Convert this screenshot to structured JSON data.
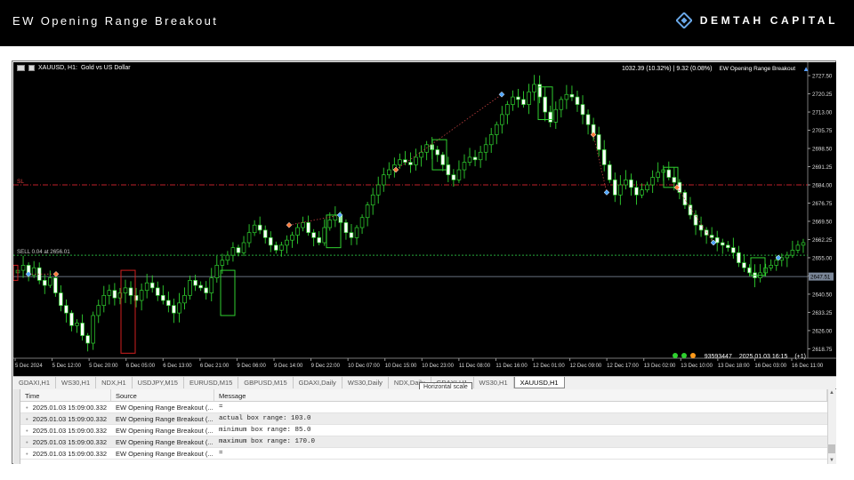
{
  "banner": {
    "title": "EW Opening Range Breakout",
    "brand": "DEMTAH CAPITAL"
  },
  "chart": {
    "symbol": "XAUUSD, H1:",
    "description": "Gold vs US Dollar",
    "account_info": "1032.39 (10.32%) | 9.32 (0.08%)",
    "ea_label": "EW Opening Range Breakout",
    "sl_label": "SL",
    "sell_label": "SELL 0.04 at 2656.01",
    "current_price": "2647.51",
    "account_number": "93593447",
    "server_time": "2025.01.03 16:15",
    "ping": "(+1)",
    "status_colors": [
      "#2fd12f",
      "#2fd12f",
      "#ff9a1a"
    ],
    "y_ticks": [
      "2727.50",
      "2720.25",
      "2713.00",
      "2705.75",
      "2698.50",
      "2691.25",
      "2684.00",
      "2676.75",
      "2669.50",
      "2662.25",
      "2655.00",
      "2647.75",
      "2640.50",
      "2633.25",
      "2626.00",
      "2618.75"
    ],
    "x_ticks": [
      "5 Dec 2024",
      "5 Dec 12:00",
      "5 Dec 20:00",
      "6 Dec 05:00",
      "6 Dec 13:00",
      "6 Dec 21:00",
      "9 Dec 06:00",
      "9 Dec 14:00",
      "9 Dec 22:00",
      "10 Dec 07:00",
      "10 Dec 15:00",
      "10 Dec 23:00",
      "11 Dec 08:00",
      "11 Dec 16:00",
      "12 Dec 01:00",
      "12 Dec 09:00",
      "12 Dec 17:00",
      "13 Dec 02:00",
      "13 Dec 10:00",
      "13 Dec 18:00",
      "16 Dec 03:00",
      "16 Dec 11:00"
    ]
  },
  "chart_data": {
    "type": "candlestick",
    "ylim": [
      2615,
      2730
    ],
    "close_path": [
      2650,
      2652,
      2648,
      2651,
      2646,
      2644,
      2647,
      2641,
      2636,
      2633,
      2628,
      2629,
      2624,
      2621,
      2632,
      2636,
      2640,
      2642,
      2639,
      2641,
      2643,
      2640,
      2638,
      2642,
      2645,
      2643,
      2640,
      2638,
      2636,
      2633,
      2637,
      2640,
      2646,
      2644,
      2643,
      2641,
      2647,
      2652,
      2654,
      2656,
      2659,
      2657,
      2661,
      2665,
      2668,
      2666,
      2663,
      2660,
      2658,
      2660,
      2662,
      2664,
      2667,
      2669,
      2665,
      2663,
      2661,
      2667,
      2670,
      2672,
      2669,
      2665,
      2663,
      2667,
      2671,
      2676,
      2680,
      2684,
      2688,
      2690,
      2692,
      2694,
      2693,
      2692,
      2695,
      2697,
      2700,
      2698,
      2696,
      2692,
      2688,
      2686,
      2690,
      2693,
      2695,
      2694,
      2697,
      2700,
      2704,
      2708,
      2712,
      2716,
      2719,
      2718,
      2716,
      2721,
      2724,
      2719,
      2713,
      2709,
      2714,
      2718,
      2720,
      2719,
      2716,
      2712,
      2708,
      2704,
      2698,
      2692,
      2686,
      2680,
      2684,
      2686,
      2683,
      2680,
      2682,
      2684,
      2687,
      2689,
      2690,
      2687,
      2685,
      2681,
      2676,
      2672,
      2668,
      2666,
      2664,
      2663,
      2661,
      2660,
      2659,
      2657,
      2653,
      2651,
      2649,
      2647,
      2649,
      2651,
      2652,
      2654,
      2655,
      2656,
      2658,
      2660,
      2661
    ]
  },
  "tabs": [
    "GDAXI,H1",
    "WS30,H1",
    "NDX,H1",
    "USDJPY,M15",
    "EURUSD,M15",
    "GBPUSD,M15",
    "GDAXI,Daily",
    "WS30,Daily",
    "NDX,Daily",
    "GDAXI,H1",
    "WS30,H1",
    "XAUUSD,H1"
  ],
  "tooltip": "Horizontal scale",
  "log": {
    "headers": {
      "time": "Time",
      "source": "Source",
      "message": "Message"
    },
    "rows": [
      {
        "time": "2025.01.03 15:09:00.332",
        "source": "EW Opening Range Breakout (...",
        "message": "="
      },
      {
        "time": "2025.01.03 15:09:00.332",
        "source": "EW Opening Range Breakout (...",
        "message": "actual box range: 103.0"
      },
      {
        "time": "2025.01.03 15:09:00.332",
        "source": "EW Opening Range Breakout (...",
        "message": "minimum box range: 85.0"
      },
      {
        "time": "2025.01.03 15:09:00.332",
        "source": "EW Opening Range Breakout (...",
        "message": "maximum box range: 170.0"
      },
      {
        "time": "2025.01.03 15:09:00.332",
        "source": "EW Opening Range Breakout (...",
        "message": "="
      }
    ]
  }
}
